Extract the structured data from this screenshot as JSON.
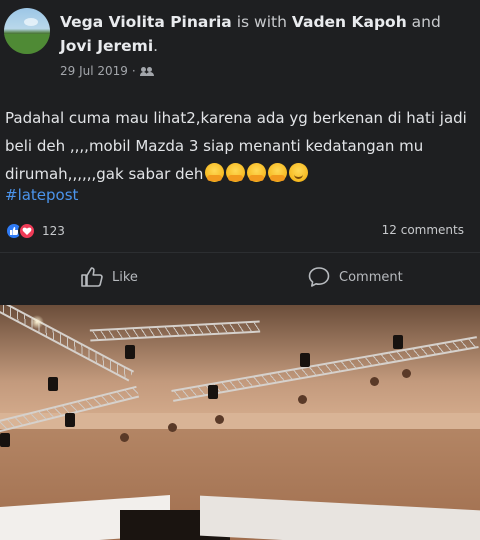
{
  "post": {
    "author": "Vega Violita Pinaria",
    "with_text": " is with ",
    "tagged_1": "Vaden Kapoh",
    "and_text": " and ",
    "tagged_2": "Jovi Jeremi",
    "suffix": ".",
    "date": "29 Jul 2019",
    "separator": " · ",
    "audience_icon": "friends-icon",
    "text": "Padahal cuma mau lihat2,karena ada yg berkenan di hati jadi beli deh ,,,,mobil Mazda 3  siap menanti kedatangan mu dirumah,,,,,,gak sabar deh",
    "emojis": [
      "hugging-face-emoji",
      "hugging-face-emoji",
      "hugging-face-emoji",
      "hugging-face-emoji",
      "smiling-face-emoji"
    ],
    "hashtag": "#latepost",
    "reaction_count": "123",
    "comments_count": "12 comments",
    "reaction_icons": [
      "like-reaction-icon",
      "love-reaction-icon"
    ]
  },
  "actions": {
    "like_label": "Like",
    "comment_label": "Comment"
  },
  "colors": {
    "background": "#1e1f21",
    "hashtag": "#4b94ec",
    "like_reaction": "#2f7bf5",
    "love_reaction": "#ef3b57"
  }
}
